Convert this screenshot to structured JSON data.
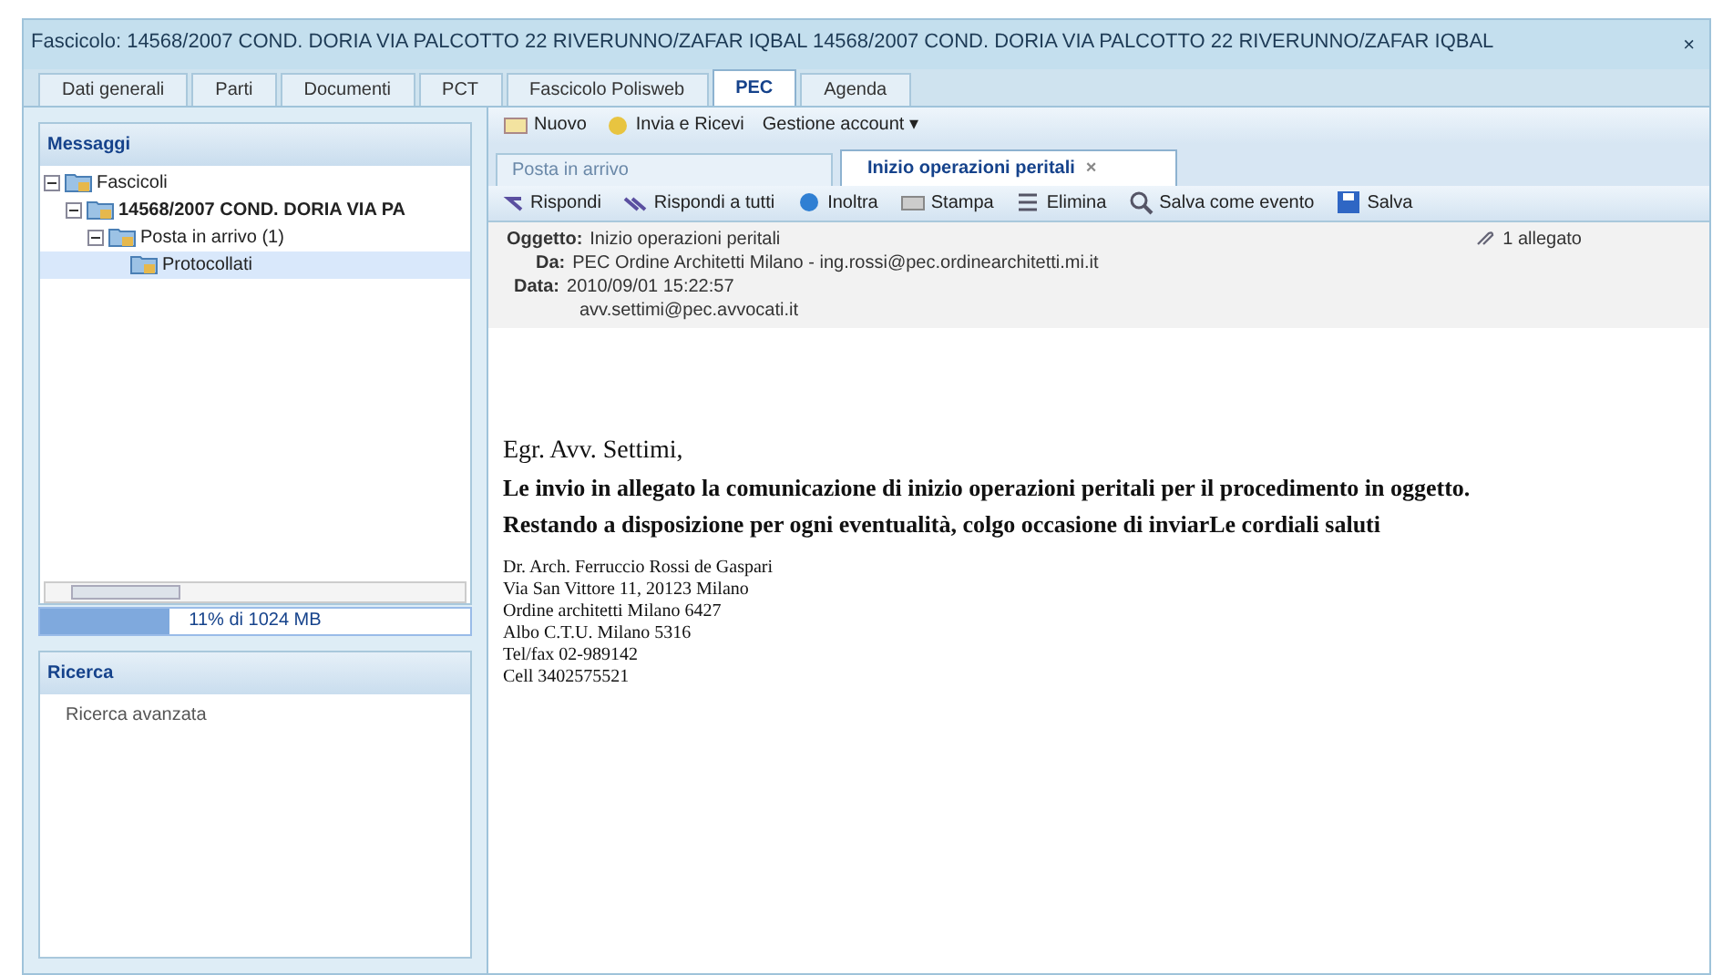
{
  "window": {
    "title": "Fascicolo: 14568/2007 COND. DORIA VIA PALCOTTO 22 RIVERUNNO/ZAFAR IQBAL 14568/2007 COND. DORIA VIA PALCOTTO 22 RIVERUNNO/ZAFAR IQBAL",
    "close": "×"
  },
  "tabs": [
    {
      "label": "Dati generali",
      "selected": false
    },
    {
      "label": "Parti",
      "selected": false
    },
    {
      "label": "Documenti",
      "selected": false
    },
    {
      "label": "PCT",
      "selected": false
    },
    {
      "label": "Fascicolo Polisweb",
      "selected": false
    },
    {
      "label": "PEC",
      "selected": true
    },
    {
      "label": "Agenda",
      "selected": false
    }
  ],
  "messages_panel": {
    "title": "Messaggi",
    "tree": [
      {
        "label": "Fascicoli",
        "expanded": true,
        "selected": false,
        "children": [
          {
            "label": "14568/2007 COND. DORIA VIA PA",
            "bold": true,
            "expanded": true,
            "selected": false,
            "children": [
              {
                "label": "Posta in arrivo (1)",
                "expanded": true,
                "selected": false,
                "children": [
                  {
                    "label": "Protocollati",
                    "selected": true
                  }
                ]
              }
            ]
          }
        ]
      }
    ],
    "quota": {
      "level": 0.3,
      "reading": "11% di 1024 MB"
    }
  },
  "search_panel": {
    "title": "Ricerca",
    "link": "Ricerca avanzata"
  },
  "toolbar": [
    "Nuovo",
    "Invia e Ricevi",
    "Gestione account ▾"
  ],
  "mail_tabs": [
    {
      "label": "Posta in arrivo",
      "selected": false
    },
    {
      "label": "Inizio operazioni peritali",
      "selected": true,
      "close": "×"
    }
  ],
  "actions": [
    "Rispondi",
    "Rispondi a tutti",
    "Inoltra",
    "Stampa",
    "Elimina",
    "Salva come evento",
    "Salva"
  ],
  "header": {
    "subject_label": "Oggetto:",
    "subject": "Inizio operazioni peritali",
    "attachment": "1 allegato",
    "from_label": "Da:",
    "from": "PEC Ordine Architetti Milano - ing.rossi@pec.ordinearchitetti.mi.it",
    "date_label": "Data:",
    "date": "2010/09/01 15:22:57",
    "to": "avv.settimi@pec.avvocati.it"
  },
  "body": {
    "greeting": "Egr. Avv. Settimi,",
    "paragraphs": [
      "Le invio in allegato la comunicazione di inizio operazioni peritali per il procedimento in oggetto.",
      "Restando a disposizione per ogni eventualità, colgo occasione di inviarLe cordiali saluti"
    ],
    "signature": [
      "Dr. Arch. Ferruccio Rossi de Gaspari",
      "Via San Vittore 11, 20123 Milano",
      "Ordine architetti Milano 6427",
      "Albo C.T.U. Milano 5316",
      "Tel/fax 02-989142",
      "Cell 3402575521"
    ]
  }
}
